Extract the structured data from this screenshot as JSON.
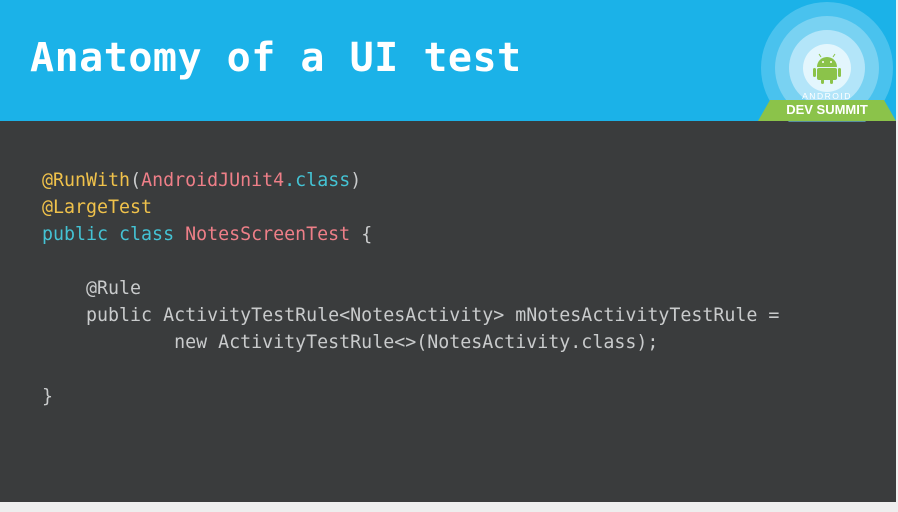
{
  "slide": {
    "title": "Anatomy of a UI test",
    "badge": {
      "icon": "android-robot-icon",
      "line1": "ANDROID",
      "line2": "DEV SUMMIT"
    },
    "code": {
      "line1": {
        "annotation": "@RunWith",
        "open": "(",
        "class_name": "AndroidJUnit4",
        "dot_class": ".class",
        "close": ")"
      },
      "line2": {
        "annotation": "@LargeTest"
      },
      "line3": {
        "kw": "public class",
        "class_name": "NotesScreenTest",
        "brace": "{"
      },
      "line5": {
        "text": "@Rule"
      },
      "line6": {
        "text": "public ActivityTestRule<NotesActivity> mNotesActivityTestRule ="
      },
      "line7": {
        "text": "new ActivityTestRule<>(NotesActivity.class);"
      },
      "line9": {
        "text": "}"
      }
    }
  },
  "colors": {
    "header_bg": "#1bb2e8",
    "slide_bg": "#3a3c3d",
    "annotation": "#f0c24b",
    "string_class": "#ee7f88",
    "keyword": "#44c3d4",
    "plain_text": "#c9cbcc",
    "badge_green": "#8bc34a"
  }
}
